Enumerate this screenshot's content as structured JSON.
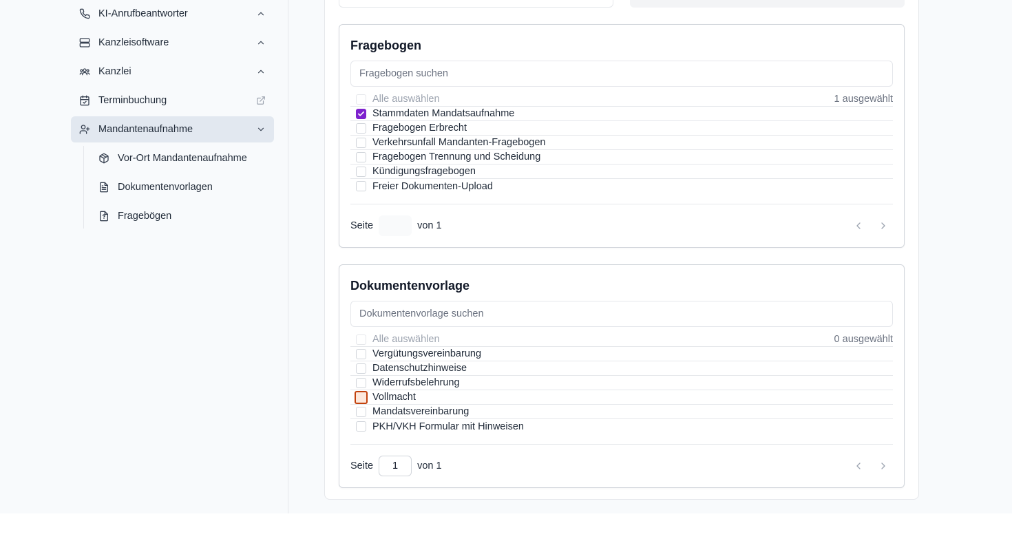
{
  "sidebar": {
    "items": [
      {
        "label": "KI-Anrufbeantworter",
        "icon": "phone-icon",
        "trail": "chevron-up-icon"
      },
      {
        "label": "Kanzleisoftware",
        "icon": "server-icon",
        "trail": "chevron-up-icon"
      },
      {
        "label": "Kanzlei",
        "icon": "users-icon",
        "trail": "chevron-up-icon"
      },
      {
        "label": "Terminbuchung",
        "icon": "calendar-check-icon",
        "trail": "external-link-icon"
      },
      {
        "label": "Mandantenaufnahme",
        "icon": "user-plus-icon",
        "trail": "chevron-down-icon",
        "active": true
      }
    ],
    "sub_items": [
      {
        "label": "Vor-Ort Mandantenaufnahme",
        "icon": "package-icon"
      },
      {
        "label": "Dokumentenvorlagen",
        "icon": "file-text-icon"
      },
      {
        "label": "Fragebögen",
        "icon": "file-question-icon"
      }
    ]
  },
  "fragebogen": {
    "title": "Fragebogen",
    "search_placeholder": "Fragebogen suchen",
    "select_all": "Alle auswählen",
    "selected_count": "1 ausgewählt",
    "items": [
      {
        "label": "Stammdaten Mandatsaufnahme",
        "checked": true
      },
      {
        "label": "Fragebogen Erbrecht",
        "checked": false
      },
      {
        "label": "Verkehrsunfall Mandanten-Fragebogen",
        "checked": false
      },
      {
        "label": "Fragebogen Trennung und Scheidung",
        "checked": false
      },
      {
        "label": "Kündigungsfragebogen",
        "checked": false
      },
      {
        "label": "Freier Dokumenten-Upload",
        "checked": false
      }
    ],
    "page_label": "Seite",
    "page_value": "",
    "of_label": "von 1"
  },
  "dokumentenvorlage": {
    "title": "Dokumentenvorlage",
    "search_placeholder": "Dokumentenvorlage suchen",
    "select_all": "Alle auswählen",
    "selected_count": "0 ausgewählt",
    "items": [
      {
        "label": "Vergütungsvereinbarung",
        "checked": false
      },
      {
        "label": "Datenschutzhinweise",
        "checked": false
      },
      {
        "label": "Widerrufsbelehrung",
        "checked": false
      },
      {
        "label": "Vollmacht",
        "checked": false,
        "focused": true
      },
      {
        "label": "Mandatsvereinbarung",
        "checked": false
      },
      {
        "label": "PKH/VKH Formular mit Hinweisen",
        "checked": false
      }
    ],
    "page_label": "Seite",
    "page_value": "1",
    "of_label": "von 1"
  },
  "colors": {
    "accent": "#7e22ce",
    "focus": "#c2410c",
    "active_nav": "#e2e8f0"
  }
}
